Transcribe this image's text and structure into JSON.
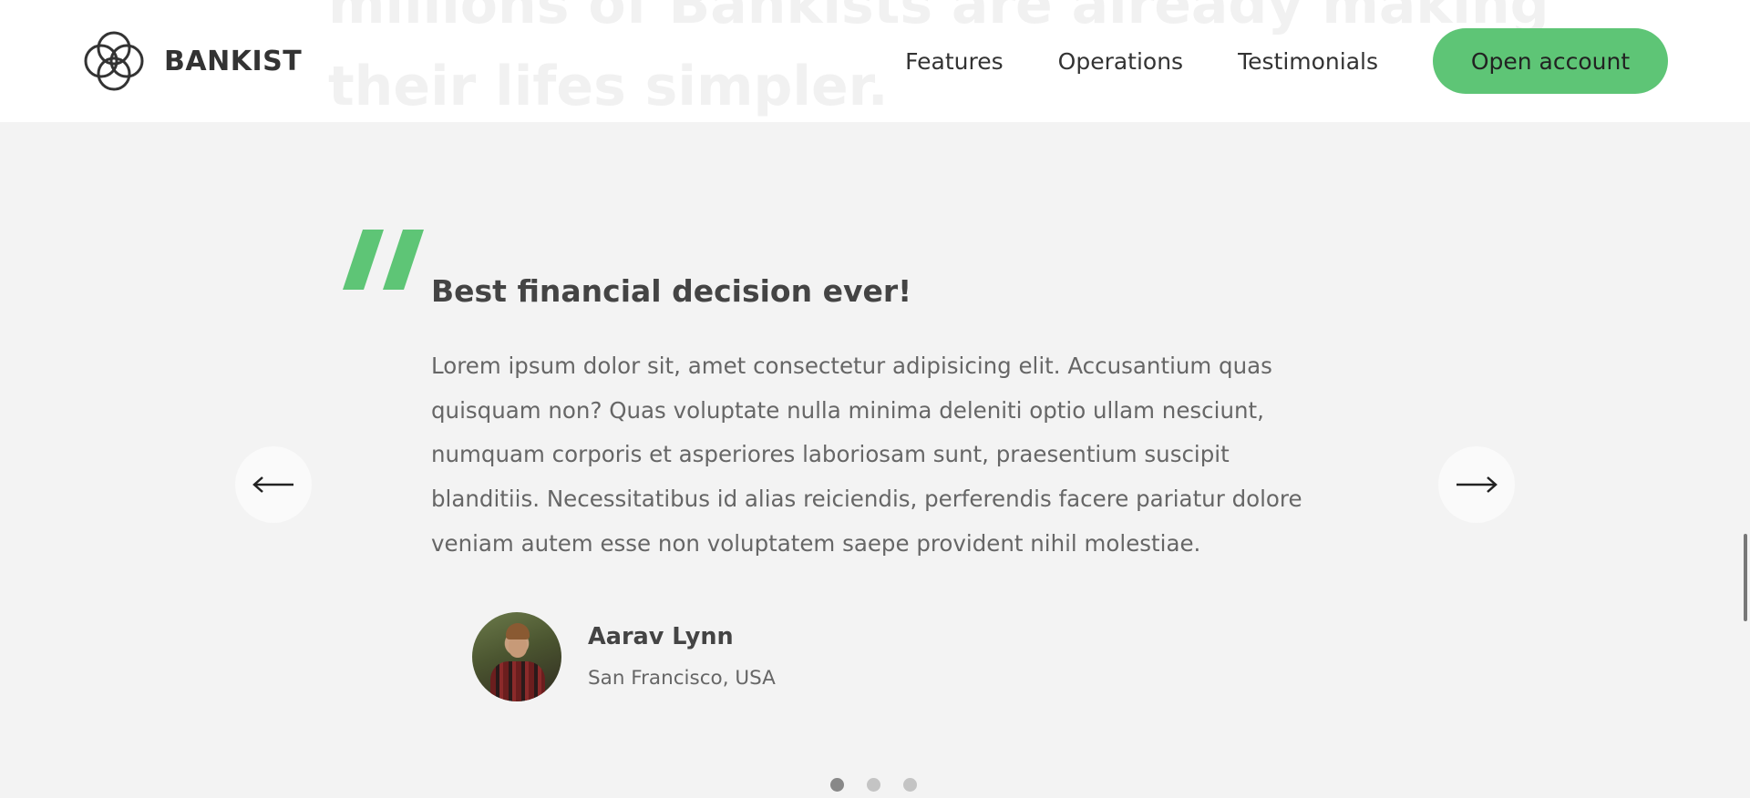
{
  "background_heading": {
    "line1": "millions of Bankists are already making",
    "line2": "their lifes simpler."
  },
  "nav": {
    "brand": "BANKIST",
    "logo_icon": "bankist-logo-icon",
    "links": [
      "Features",
      "Operations",
      "Testimonials"
    ],
    "cta": "Open account"
  },
  "testimonial": {
    "quote_icon": "quote-mark-icon",
    "title": "Best financial decision ever!",
    "text": "Lorem ipsum dolor sit, amet consectetur adipisicing elit. Accusantium quas quisquam non? Quas voluptate nulla minima deleniti optio ullam nesciunt, numquam corporis et asperiores laboriosam sunt, praesentium suscipit blanditiis. Necessitatibus id alias reiciendis, perferendis facere pariatur dolore veniam autem esse non voluptatem saepe provident nihil molestiae.",
    "author": {
      "name": "Aarav Lynn",
      "location": "San Francisco, USA"
    }
  },
  "slider": {
    "left_icon": "arrow-left-icon",
    "right_icon": "arrow-right-icon",
    "dot_count": 3,
    "active_dot": 0
  },
  "colors": {
    "accent": "#5ec576",
    "background": "#f3f3f3",
    "nav_background": "#ffffff",
    "text_dark": "#444444",
    "text_muted": "#666666"
  }
}
